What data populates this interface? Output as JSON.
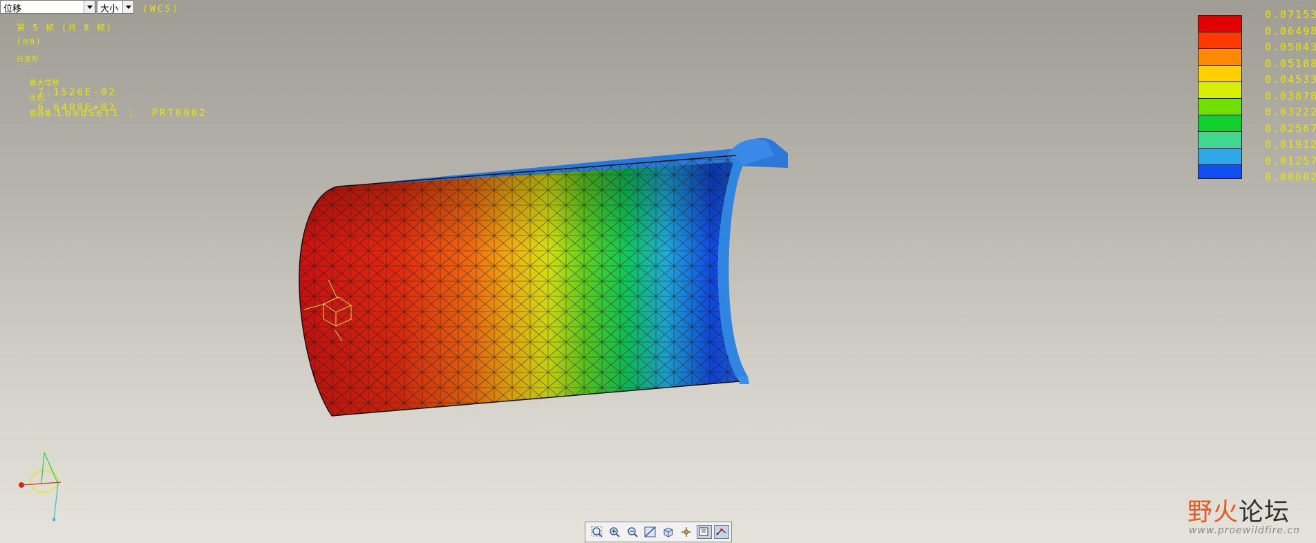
{
  "controls": {
    "result_select": "位移",
    "component_select": "大小"
  },
  "overlay": {
    "coord_system": "(WCS)",
    "frame": "第 5 帧 (共 8 帧)",
    "unit": "(mm)",
    "deformed": "已变形",
    "max_disp_label": "最大位移",
    "max_disp_value": "7.1526E-02",
    "scale_label": "比例",
    "scale_value": "6.6409E+02",
    "loadset_label": "载荷集:",
    "loadset_value": "LoadSet1 :  PRT0002"
  },
  "legend": {
    "values": [
      "0.07153",
      "0.06498",
      "0.05843",
      "0.05188",
      "0.04533",
      "0.03878",
      "0.03222",
      "0.02567",
      "0.01912",
      "0.01257",
      "0.00602"
    ],
    "colors": [
      "#e00000",
      "#ff3a00",
      "#ff8a00",
      "#ffd000",
      "#d8f000",
      "#70e000",
      "#10d030",
      "#40d890",
      "#30a8e8",
      "#1050f0",
      "#0000c0"
    ]
  },
  "toolbar": {
    "icons": [
      "zoom-fit-icon",
      "zoom-in-icon",
      "zoom-out-icon",
      "repaint-icon",
      "orient-icon",
      "spin-center-icon",
      "display-style-icon",
      "datum-display-icon"
    ]
  },
  "watermark": {
    "title_red": "野火",
    "title_dark": "论坛",
    "url": "www.proewildfire.cn"
  }
}
